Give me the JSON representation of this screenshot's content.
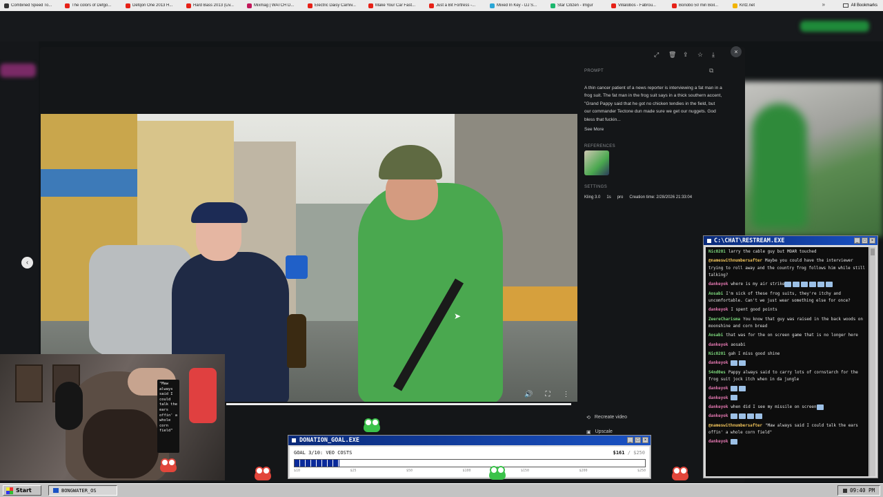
{
  "bookmarks": [
    {
      "label": "Combined Speed To...",
      "color": "#333333"
    },
    {
      "label": "The colors of Defgo...",
      "color": "#e62117"
    },
    {
      "label": "Defqon One 2013 H...",
      "color": "#e62117"
    },
    {
      "label": "Hard Bass 2013 (Liv...",
      "color": "#e62117"
    },
    {
      "label": "Mixmag | WATCH D...",
      "color": "#c2185b"
    },
    {
      "label": "Electric Daisy Carniv...",
      "color": "#e62117"
    },
    {
      "label": "Make Your Car Fast...",
      "color": "#e62117"
    },
    {
      "label": "Just a Bit Fortress -...",
      "color": "#e62117"
    },
    {
      "label": "Mixed In Key - DJ S...",
      "color": "#2aa6d6"
    },
    {
      "label": "Star Citizen - Imgur",
      "color": "#1bb76e"
    },
    {
      "label": "Villalobos - Fabrou...",
      "color": "#e62117"
    },
    {
      "label": "Bonobo 50 min Boil...",
      "color": "#e62117"
    },
    {
      "label": "Kritz.net",
      "color": "#f2b400"
    }
  ],
  "bookmarks_more": "»",
  "all_bookmarks": "All Bookmarks",
  "modal": {
    "close": "×",
    "toolbar_icons": [
      "expand-icon",
      "trash-icon",
      "share-icon",
      "star-icon",
      "download-icon"
    ],
    "prompt_label": "PROMPT",
    "prompt_text": "A thin cancer patient of a news reporter is interviewing a fat man in a frog suit. The fat man in the frog suit says in a thick southern accent, \"Grand Pappy said that he got no chicken tendies in the field, but our commander Tectone dun made sure we get our nuggets. God bless that fuckin...",
    "see_more": "See More",
    "references_label": "REFERENCES",
    "settings_label": "SETTINGS",
    "settings": [
      "Kling 3.0",
      "1s",
      "pro",
      "Creation time: 2/28/2026 21:33:04"
    ],
    "recreate": "Recreate video",
    "upscale": "Upscale",
    "nav_prev": "‹"
  },
  "webcam_quote": "\"Maw always said I could talk the ears offin' a whole corn field\"",
  "donation": {
    "title": "DONATION_GOAL.EXE",
    "goal": "GOAL 3/10: VEO COSTS",
    "amount": "$161",
    "total": "/ $250",
    "progress": 0.644,
    "ticks": [
      "$10",
      "$25",
      "$50",
      "$100",
      "$150",
      "$200",
      "$250"
    ]
  },
  "chat": {
    "title": "C:\\CHAT\\RESTREAM.EXE",
    "messages": [
      {
        "user": "Nic0201",
        "cls": "",
        "text": "larry the cable guy but MOAR touched"
      },
      {
        "user": "@nameswithnumbersafter",
        "cls": "c",
        "text": "Maybe you could have the interviewer trying to roll away and the country frog follows him while still talking?"
      },
      {
        "user": "dankeyok",
        "cls": "a",
        "text": "where is my air strike",
        "emotes": 6
      },
      {
        "user": "Aosabi",
        "cls": "",
        "text": "I'm sick of these frog suits, they're itchy and uncomfortable. Can't we just wear something else for once?"
      },
      {
        "user": "dankeyok",
        "cls": "a",
        "text": "I spent good points"
      },
      {
        "user": "ZeereCharisma",
        "cls": "",
        "text": "You know that guy was raised in the back woods on moonshine and corn bread"
      },
      {
        "user": "Aosabi",
        "cls": "",
        "text": "that was for the on screen game that is no longer here"
      },
      {
        "user": "dankeyok",
        "cls": "a",
        "text": "aosabi"
      },
      {
        "user": "Nic0201",
        "cls": "",
        "text": "gah I miss good shine"
      },
      {
        "user": "dankeyok",
        "cls": "a",
        "text": "",
        "emotes": 2
      },
      {
        "user": "S4nd0es",
        "cls": "",
        "text": "Pappy always said to carry lots of cornstarch for the frog suit jock itch when in da jungle"
      },
      {
        "user": "dankeyok",
        "cls": "a",
        "text": "",
        "emotes": 2
      },
      {
        "user": "dankeyok",
        "cls": "a",
        "text": "",
        "emotes": 1
      },
      {
        "user": "dankeyok",
        "cls": "a",
        "text": "when did I see my missile on screen",
        "emotes": 1
      },
      {
        "user": "dankeyok",
        "cls": "a",
        "text": "",
        "emotes": 4
      },
      {
        "user": "@nameswithnumbersafter",
        "cls": "c",
        "text": "\"Maw always said I could talk the ears offin' a whole corn field\""
      },
      {
        "user": "dankeyok",
        "cls": "a",
        "text": "",
        "emotes": 1
      }
    ]
  },
  "taskbar": {
    "start": "Start",
    "app": "BONGWATER_OS",
    "clock": "09:40 PM"
  }
}
